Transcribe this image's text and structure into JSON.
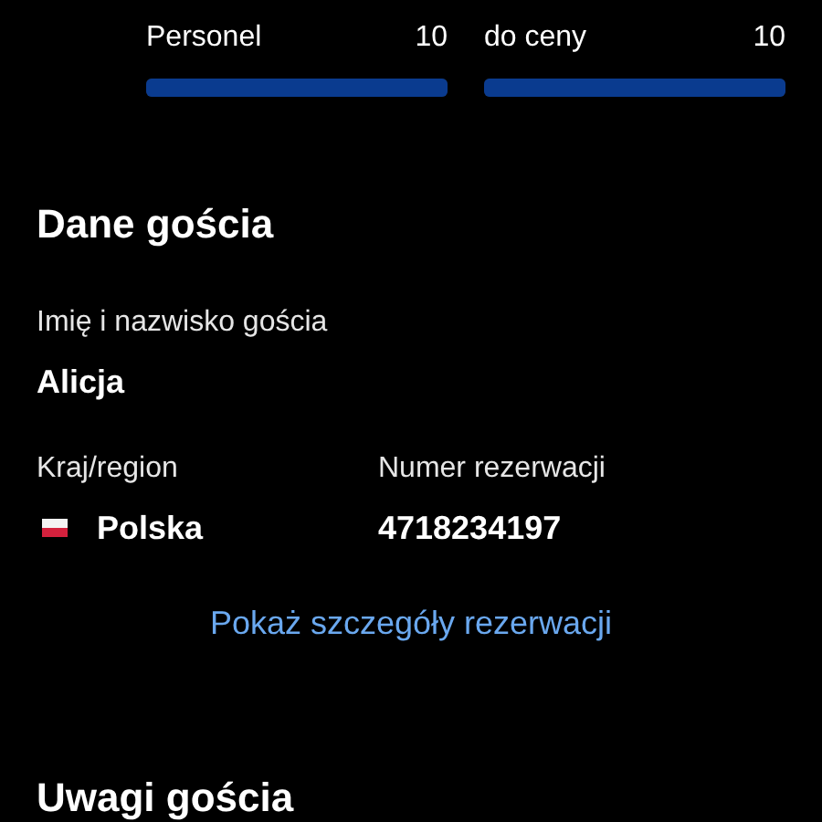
{
  "ratings": [
    {
      "label_lines": [
        "Personel"
      ],
      "score": "10",
      "level": 1
    },
    {
      "label_lines": [
        "do ceny"
      ],
      "score": "10",
      "level": 1
    }
  ],
  "guest_section": {
    "title": "Dane gościa",
    "name_label": "Imię i nazwisko gościa",
    "name": "Alicja",
    "country_label": "Kraj/region",
    "country": "Polska",
    "booking_label": "Numer rezerwacji",
    "booking_number": "4718234197",
    "details_link": "Pokaż szczegóły rezerwacji"
  },
  "notes_section": {
    "title": "Uwagi gościa"
  }
}
